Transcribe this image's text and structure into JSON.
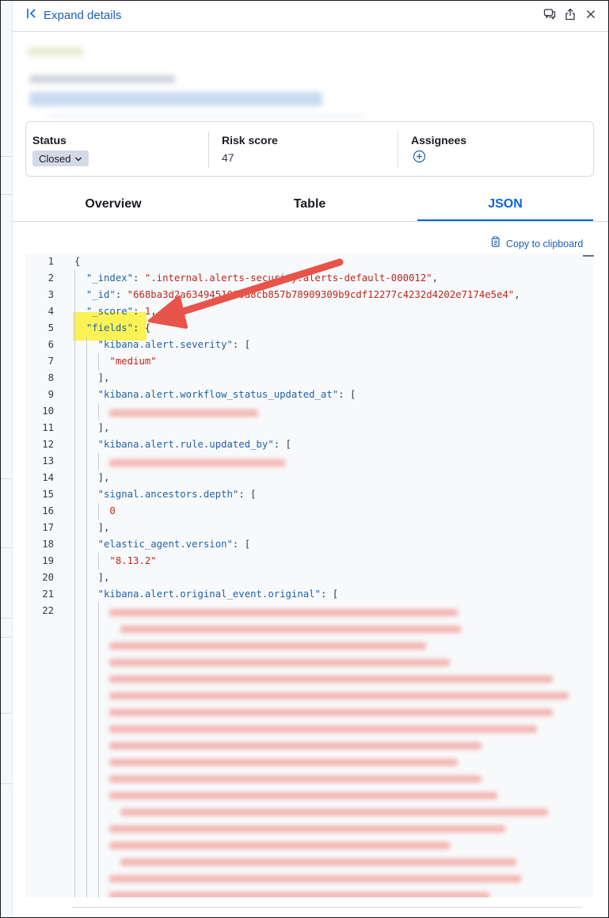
{
  "header": {
    "expand_label": "Expand details"
  },
  "summary": {
    "status_title": "Status",
    "status_value": "Closed",
    "risk_title": "Risk score",
    "risk_value": "47",
    "assignees_title": "Assignees"
  },
  "tabs": [
    {
      "label": "Overview",
      "active": false
    },
    {
      "label": "Table",
      "active": false
    },
    {
      "label": "JSON",
      "active": true
    }
  ],
  "copy_label": "Copy to clipboard",
  "code_lines": [
    {
      "n": "1",
      "parts": [
        [
          "p",
          "{"
        ]
      ]
    },
    {
      "n": "2",
      "parts": [
        [
          "p",
          "  "
        ],
        [
          "k",
          "\"_index\""
        ],
        [
          "p",
          ": "
        ],
        [
          "s",
          "\".internal.alerts-security.alerts-default-000012\""
        ],
        [
          "p",
          ","
        ]
      ]
    },
    {
      "n": "3",
      "parts": [
        [
          "p",
          "  "
        ],
        [
          "k",
          "\"_id\""
        ],
        [
          "p",
          ": "
        ],
        [
          "s",
          "\"668ba3d2a6349451000a8cb857b78909309b9cdf12277c4232d4202e7174e5e4\""
        ],
        [
          "p",
          ","
        ]
      ]
    },
    {
      "n": "4",
      "parts": [
        [
          "p",
          "  "
        ],
        [
          "k",
          "\"_score\""
        ],
        [
          "p",
          ": "
        ],
        [
          "n",
          "1"
        ],
        [
          "p",
          ","
        ]
      ]
    },
    {
      "n": "5",
      "parts": [
        [
          "p",
          "  "
        ],
        [
          "k",
          "\"fields\""
        ],
        [
          "p",
          ": {"
        ]
      ]
    },
    {
      "n": "6",
      "parts": [
        [
          "p",
          "    "
        ],
        [
          "k",
          "\"kibana.alert.severity\""
        ],
        [
          "p",
          ": ["
        ]
      ]
    },
    {
      "n": "7",
      "parts": [
        [
          "p",
          "      "
        ],
        [
          "s",
          "\"medium\""
        ]
      ]
    },
    {
      "n": "8",
      "parts": [
        [
          "p",
          "    ],"
        ]
      ]
    },
    {
      "n": "9",
      "parts": [
        [
          "p",
          "    "
        ],
        [
          "k",
          "\"kibana.alert.workflow_status_updated_at\""
        ],
        [
          "p",
          ": ["
        ]
      ]
    },
    {
      "n": "10",
      "parts": []
    },
    {
      "n": "11",
      "parts": [
        [
          "p",
          "    ],"
        ]
      ]
    },
    {
      "n": "12",
      "parts": [
        [
          "p",
          "    "
        ],
        [
          "k",
          "\"kibana.alert.rule.updated_by\""
        ],
        [
          "p",
          ": ["
        ]
      ]
    },
    {
      "n": "13",
      "parts": []
    },
    {
      "n": "14",
      "parts": [
        [
          "p",
          "    ],"
        ]
      ]
    },
    {
      "n": "15",
      "parts": [
        [
          "p",
          "    "
        ],
        [
          "k",
          "\"signal.ancestors.depth\""
        ],
        [
          "p",
          ": ["
        ]
      ]
    },
    {
      "n": "16",
      "parts": [
        [
          "p",
          "      "
        ],
        [
          "n",
          "0"
        ]
      ]
    },
    {
      "n": "17",
      "parts": [
        [
          "p",
          "    ],"
        ]
      ]
    },
    {
      "n": "18",
      "parts": [
        [
          "p",
          "    "
        ],
        [
          "k",
          "\"elastic_agent.version\""
        ],
        [
          "p",
          ": ["
        ]
      ]
    },
    {
      "n": "19",
      "parts": [
        [
          "p",
          "      "
        ],
        [
          "s",
          "\"8.13.2\""
        ]
      ]
    },
    {
      "n": "20",
      "parts": [
        [
          "p",
          "    ],"
        ]
      ]
    },
    {
      "n": "21",
      "parts": [
        [
          "p",
          "    "
        ],
        [
          "k",
          "\"kibana.alert.original_event.original\""
        ],
        [
          "p",
          ": ["
        ]
      ]
    },
    {
      "n": "22",
      "parts": []
    }
  ],
  "icons": {
    "expand": "expand-left-icon",
    "comment": "comment-icon",
    "share": "share-icon",
    "close": "close-icon",
    "chevron": "chevron-down-icon",
    "add": "plus-circle-icon",
    "copy": "copy-clipboard-icon"
  },
  "colors": {
    "accent": "#0b64dd",
    "json_key": "#1f62a8",
    "json_string": "#bd271e",
    "highlight": "#fbf356",
    "arrow": "#e8544a"
  }
}
